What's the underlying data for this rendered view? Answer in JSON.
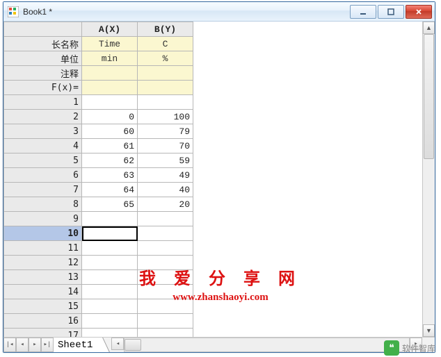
{
  "window": {
    "title": "Book1 *"
  },
  "columns": {
    "a": "A(X)",
    "b": "B(Y)"
  },
  "row_labels": {
    "longname": "长名称",
    "units": "单位",
    "comments": "注释",
    "fx": "F(x)="
  },
  "meta": {
    "longname": {
      "a": "Time",
      "b": "C"
    },
    "units": {
      "a": "min",
      "b": "%"
    },
    "comments": {
      "a": "",
      "b": ""
    },
    "fx": {
      "a": "",
      "b": ""
    }
  },
  "rows": [
    {
      "n": "1",
      "a": "",
      "b": ""
    },
    {
      "n": "2",
      "a": "0",
      "b": "100"
    },
    {
      "n": "3",
      "a": "60",
      "b": "79"
    },
    {
      "n": "4",
      "a": "61",
      "b": "70"
    },
    {
      "n": "5",
      "a": "62",
      "b": "59"
    },
    {
      "n": "6",
      "a": "63",
      "b": "49"
    },
    {
      "n": "7",
      "a": "64",
      "b": "40"
    },
    {
      "n": "8",
      "a": "65",
      "b": "20"
    },
    {
      "n": "9",
      "a": "",
      "b": ""
    },
    {
      "n": "10",
      "a": "",
      "b": ""
    },
    {
      "n": "11",
      "a": "",
      "b": ""
    },
    {
      "n": "12",
      "a": "",
      "b": ""
    },
    {
      "n": "13",
      "a": "",
      "b": ""
    },
    {
      "n": "14",
      "a": "",
      "b": ""
    },
    {
      "n": "15",
      "a": "",
      "b": ""
    },
    {
      "n": "16",
      "a": "",
      "b": ""
    },
    {
      "n": "17",
      "a": "",
      "b": ""
    }
  ],
  "selected_row": "10",
  "sheet_tab": "Sheet1",
  "watermark": {
    "line1": "我 爱 分 享 网",
    "line2": "www.zhanshaoyi.com"
  },
  "footer_wm": "软件智库"
}
